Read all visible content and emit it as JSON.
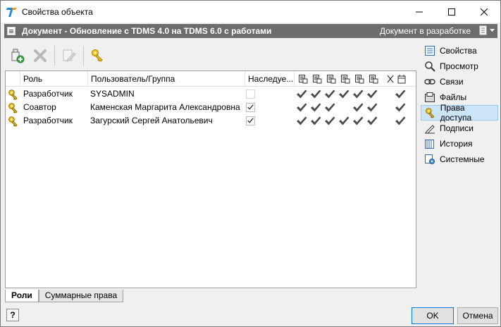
{
  "window": {
    "title": "Свойства объекта"
  },
  "header": {
    "title": "Документ - Обновление с TDMS 4.0 на TDMS 6.0 с работами",
    "status": "Документ в разработке"
  },
  "toolbar": {
    "icons": [
      "add-role-icon",
      "delete-icon",
      "edit-icon",
      "key-icon"
    ]
  },
  "grid": {
    "columns": {
      "role": "Роль",
      "user": "Пользователь/Группа",
      "inherited": "Наследуе..."
    },
    "perm_icons": [
      "doc-read-icon",
      "doc-edit-icon",
      "doc-create-icon",
      "doc-approve-icon",
      "doc-check-icon",
      "doc-copy-icon",
      "cut-icon",
      "calendar-icon"
    ],
    "rows": [
      {
        "role": "Разработчик",
        "user": "SYSADMIN",
        "inherited": false,
        "perms": [
          true,
          true,
          true,
          true,
          true,
          true,
          false,
          true
        ]
      },
      {
        "role": "Соавтор",
        "user": "Каменская Маргарита Александровна",
        "inherited": true,
        "perms": [
          true,
          true,
          true,
          false,
          true,
          true,
          false,
          true
        ]
      },
      {
        "role": "Разработчик",
        "user": "Загурский Сергей Анатольевич",
        "inherited": true,
        "perms": [
          true,
          true,
          true,
          true,
          true,
          true,
          false,
          true
        ]
      }
    ]
  },
  "tabs": [
    {
      "label": "Роли",
      "active": true
    },
    {
      "label": "Суммарные права",
      "active": false
    }
  ],
  "sidebar": {
    "items": [
      {
        "label": "Свойства",
        "icon": "list-icon",
        "active": false
      },
      {
        "label": "Просмотр",
        "icon": "magnifier-icon",
        "active": false
      },
      {
        "label": "Связи",
        "icon": "link-icon",
        "active": false
      },
      {
        "label": "Файлы",
        "icon": "files-icon",
        "active": false
      },
      {
        "label": "Права доступа",
        "icon": "key-icon",
        "active": true
      },
      {
        "label": "Подписи",
        "icon": "signature-icon",
        "active": false
      },
      {
        "label": "История",
        "icon": "history-icon",
        "active": false
      },
      {
        "label": "Системные",
        "icon": "system-icon",
        "active": false
      }
    ]
  },
  "buttons": {
    "help": "?",
    "ok": "OK",
    "cancel": "Отмена"
  }
}
